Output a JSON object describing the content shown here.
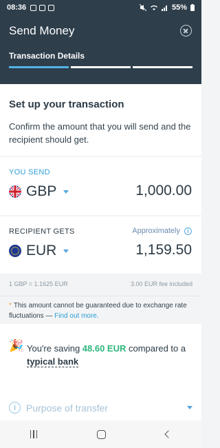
{
  "status_bar": {
    "time": "08:36",
    "battery": "55%"
  },
  "header": {
    "title": "Send Money",
    "step_label": "Transaction Details",
    "progress_steps": 3,
    "progress_current": 1
  },
  "intro": {
    "heading": "Set up your transaction",
    "description": "Confirm the amount that you will send and the recipient should get."
  },
  "send": {
    "label": "YOU SEND",
    "currency": "GBP",
    "amount": "1,000.00"
  },
  "receive": {
    "label": "RECIPIENT GETS",
    "approx_label": "Approximately",
    "currency": "EUR",
    "amount": "1,159.50"
  },
  "rate": {
    "exchange": "1 GBP = 1.1625 EUR",
    "fee": "3.00 EUR fee included"
  },
  "notice": {
    "text": "This amount cannot be guaranteed due to exchange rate fluctuations — ",
    "link": "Find out more."
  },
  "saving": {
    "prefix": "You're saving ",
    "amount": "48.60 EUR",
    "middle": " compared to a ",
    "bank": "typical bank"
  },
  "purpose": {
    "placeholder": "Purpose of transfer"
  },
  "colors": {
    "header_bg": "#2e3e4b",
    "accent": "#52b5e6",
    "saving_green": "#2db77b"
  }
}
